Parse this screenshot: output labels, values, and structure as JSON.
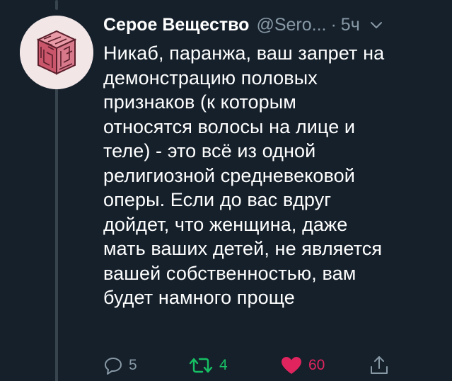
{
  "tweet": {
    "author_name": "Серое Вещество",
    "author_handle": "@Sero...",
    "separator": "·",
    "time": "5ч",
    "text": "Никаб, паранжа, ваш запрет на\nдемонстрацию половых\nпризнаков (к которым\nотносятся волосы на лице и\nтеле) - это всё из одной\nрелигиозной средневековой\nоперы. Если до вас вдруг\nдойдет, что женщина, даже\nмать ваших детей, не является\nвашей собственностью, вам\nбудет намного проще",
    "reply_count": "5",
    "retweet_count": "4",
    "like_count": "60"
  },
  "icons": {
    "avatar": "brain-cube-avatar",
    "menu": "chevron-down-icon",
    "reply": "reply-icon",
    "retweet": "retweet-icon",
    "like": "heart-icon",
    "share": "share-icon"
  },
  "colors": {
    "background": "#15202b",
    "secondary_text": "#8899a6",
    "retweet_active": "#17bf63",
    "like_active": "#e0245e"
  }
}
